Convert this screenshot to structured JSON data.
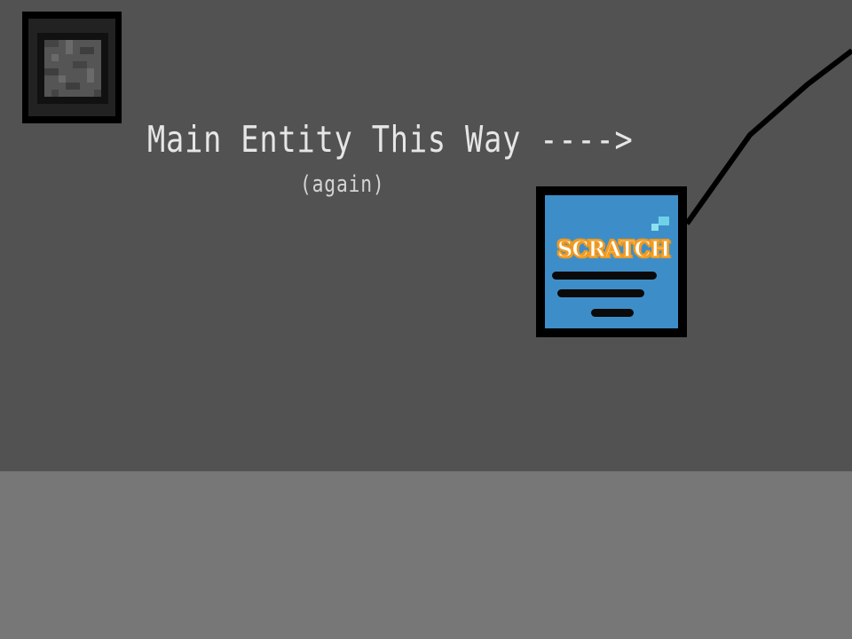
{
  "scene": {
    "main_sign": "Main Entity This Way ---->",
    "sub_sign": "(again)",
    "scratch_logo": "SCRATCH",
    "menu_button_icon": "stone-block-icon",
    "scratch_icon": "scratch-notice-icon"
  },
  "colors": {
    "wall": "#525252",
    "floor": "#777777",
    "text": "#e6e6e6",
    "scratch_blue": "#3d8ec8",
    "scratch_orange": "#f29a1e"
  }
}
